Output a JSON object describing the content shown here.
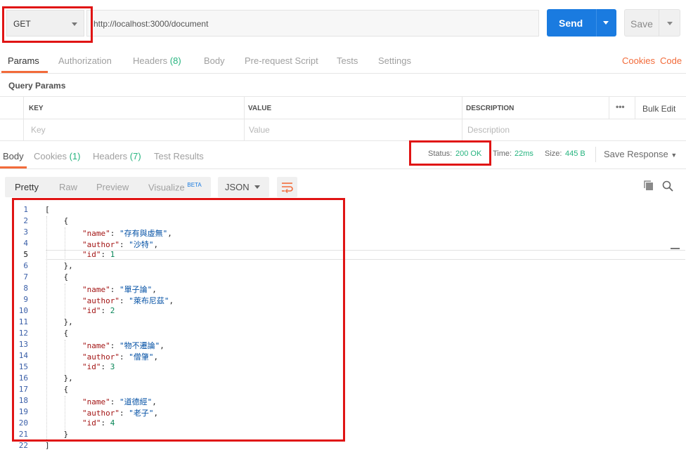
{
  "request": {
    "method": "GET",
    "url": "http://localhost:3000/document",
    "send_label": "Send",
    "save_label": "Save"
  },
  "request_tabs": {
    "params": "Params",
    "authorization": "Authorization",
    "headers": "Headers",
    "headers_count": "(8)",
    "body": "Body",
    "pre_request": "Pre-request Script",
    "tests": "Tests",
    "settings": "Settings",
    "cookies": "Cookies",
    "code": "Code"
  },
  "query_params": {
    "title": "Query Params",
    "columns": [
      "KEY",
      "VALUE",
      "DESCRIPTION"
    ],
    "placeholders": [
      "Key",
      "Value",
      "Description"
    ],
    "bulk_edit": "Bulk Edit",
    "more": "•••"
  },
  "response_tabs": {
    "body": "Body",
    "cookies": "Cookies",
    "cookies_count": "(1)",
    "headers": "Headers",
    "headers_count": "(7)",
    "test_results": "Test Results"
  },
  "response_meta": {
    "status_label": "Status:",
    "status_value": "200 OK",
    "time_label": "Time:",
    "time_value": "22ms",
    "size_label": "Size:",
    "size_value": "445 B",
    "save_response": "Save Response"
  },
  "view_modes": {
    "pretty": "Pretty",
    "raw": "Raw",
    "preview": "Preview",
    "visualize": "Visualize",
    "beta": "BETA",
    "format": "JSON"
  },
  "code_lines": [
    {
      "n": "1",
      "text": "["
    },
    {
      "n": "2",
      "text": "    {"
    },
    {
      "n": "3",
      "text": "        \"name\": \"存有與虛無\","
    },
    {
      "n": "4",
      "text": "        \"author\": \"沙特\","
    },
    {
      "n": "5",
      "text": "        \"id\": 1"
    },
    {
      "n": "6",
      "text": "    },"
    },
    {
      "n": "7",
      "text": "    {"
    },
    {
      "n": "8",
      "text": "        \"name\": \"單子論\","
    },
    {
      "n": "9",
      "text": "        \"author\": \"萊布尼茲\","
    },
    {
      "n": "10",
      "text": "        \"id\": 2"
    },
    {
      "n": "11",
      "text": "    },"
    },
    {
      "n": "12",
      "text": "    {"
    },
    {
      "n": "13",
      "text": "        \"name\": \"物不遷論\","
    },
    {
      "n": "14",
      "text": "        \"author\": \"僧肇\","
    },
    {
      "n": "15",
      "text": "        \"id\": 3"
    },
    {
      "n": "16",
      "text": "    },"
    },
    {
      "n": "17",
      "text": "    {"
    },
    {
      "n": "18",
      "text": "        \"name\": \"道德經\","
    },
    {
      "n": "19",
      "text": "        \"author\": \"老子\","
    },
    {
      "n": "20",
      "text": "        \"id\": 4"
    },
    {
      "n": "21",
      "text": "    }"
    },
    {
      "n": "22",
      "text": "]"
    }
  ],
  "current_line": "5",
  "colors": {
    "accent": "#f26b3a",
    "send": "#1a7be0",
    "status_ok": "#26b47f",
    "highlight": "#e01414"
  }
}
